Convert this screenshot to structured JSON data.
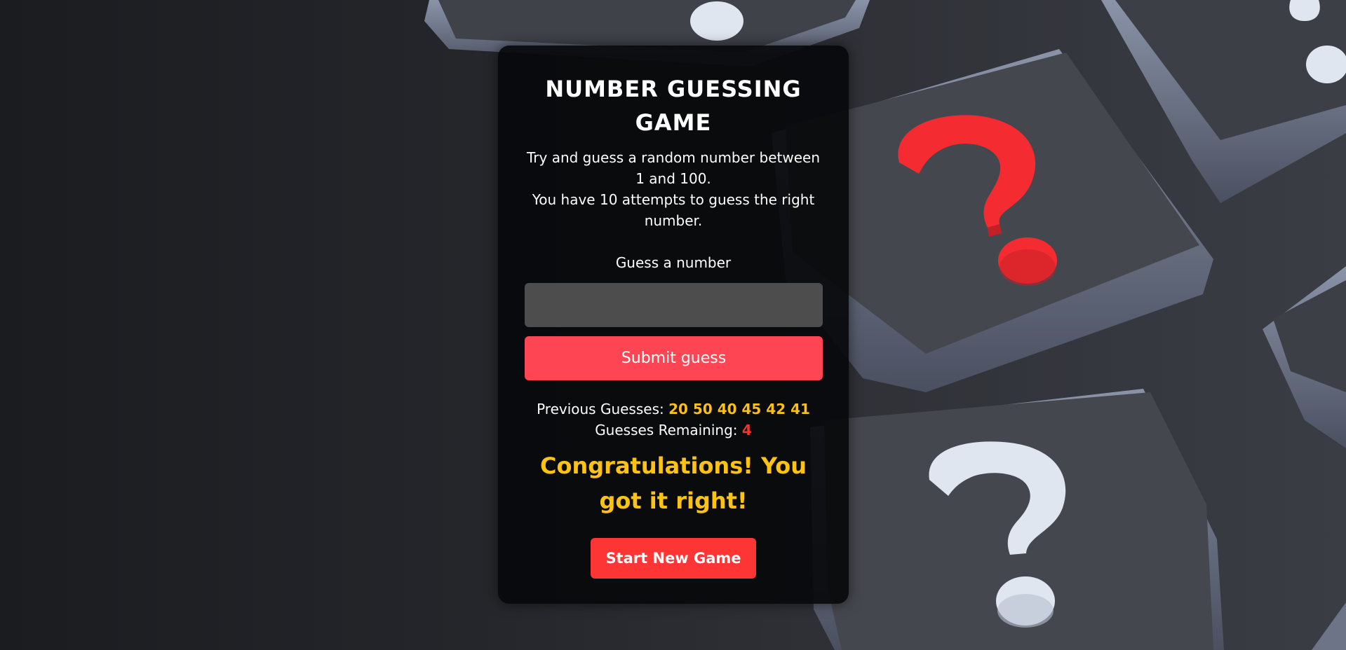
{
  "game": {
    "title": "NUMBER GUESSING GAME",
    "description_line1": "Try and guess a random number between 1 and 100.",
    "description_line2": "You have 10 attempts to guess the right number.",
    "guess_label": "Guess a number",
    "guess_input_value": "",
    "submit_label": "Submit guess",
    "previous_guesses_label": "Previous Guesses:",
    "previous_guesses": "20 50 40 45 42 41",
    "remaining_label": "Guesses Remaining:",
    "remaining_count": "4",
    "result_message": "Congratulations! You got it right!",
    "new_game_label": "Start New Game"
  },
  "colors": {
    "card_bg": "#08090b",
    "submit_button": "#fe4554",
    "new_game_button": "#fd3535",
    "input_bg": "#4d4d4e",
    "guesses_highlight": "#fbbf1a",
    "remaining_highlight": "#f0342f",
    "message_color": "#fcc312",
    "question_mark_red": "#f52b32",
    "question_mark_white": "#dfe6f0"
  },
  "background": {
    "icons": [
      "question-mark-tile-red",
      "question-mark-tile-white",
      "question-mark-tile-white"
    ]
  }
}
